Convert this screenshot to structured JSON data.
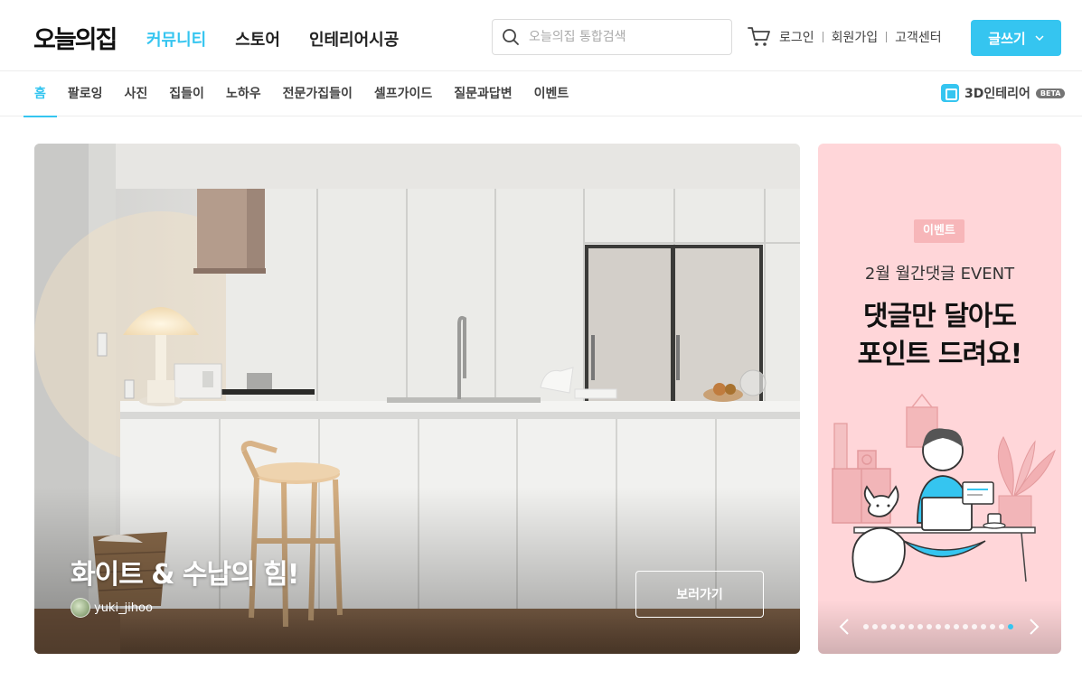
{
  "header": {
    "logo": "오늘의집",
    "nav": [
      "커뮤니티",
      "스토어",
      "인테리어시공"
    ],
    "active_nav": 0,
    "search_placeholder": "오늘의집 통합검색",
    "util_links": [
      "로그인",
      "회원가입",
      "고객센터"
    ],
    "write_button": "글쓰기"
  },
  "subnav": {
    "items": [
      "홈",
      "팔로잉",
      "사진",
      "집들이",
      "노하우",
      "전문가집들이",
      "셀프가이드",
      "질문과답변",
      "이벤트"
    ],
    "active": 0,
    "interior3d_label": "3D인테리어",
    "beta": "BETA"
  },
  "hero": {
    "title": "화이트 & 수납의 힘!",
    "username": "yuki_jihoo",
    "button": "보러가기"
  },
  "banner": {
    "badge": "이벤트",
    "subtitle": "2월 월간댓글 EVENT",
    "title_line1": "댓글만 달아도",
    "title_line2": "포인트 드려요!",
    "dot_count": 17,
    "active_dot": 16
  },
  "colors": {
    "accent": "#35c5f0",
    "banner_bg": "#ffd6d9"
  },
  "icons": [
    "search-icon",
    "cart-icon",
    "chevron-down-icon",
    "3d-interior-icon",
    "chevron-left-icon",
    "chevron-right-icon"
  ]
}
